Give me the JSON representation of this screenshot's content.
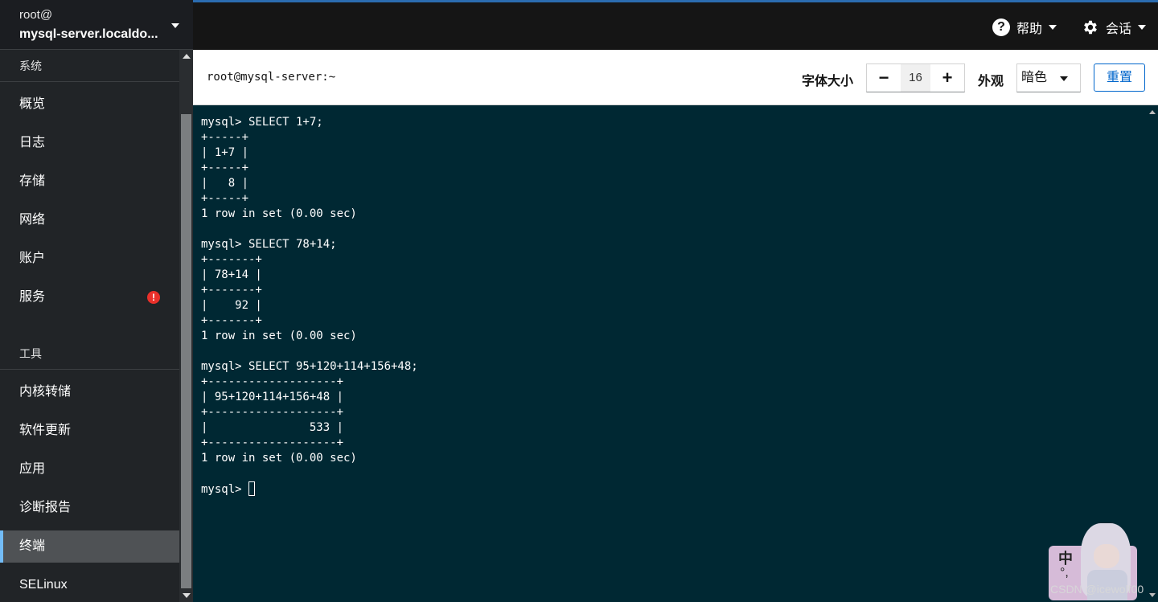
{
  "host": {
    "user": "root@",
    "name": "mysql-server.localdo..."
  },
  "sidebar": {
    "system_label": "系统",
    "tools_label": "工具",
    "items": [
      {
        "label": "概览"
      },
      {
        "label": "日志"
      },
      {
        "label": "存储"
      },
      {
        "label": "网络"
      },
      {
        "label": "账户"
      },
      {
        "label": "服务"
      }
    ],
    "tool_items": [
      {
        "label": "内核转储"
      },
      {
        "label": "软件更新"
      },
      {
        "label": "应用"
      },
      {
        "label": "诊断报告"
      },
      {
        "label": "终端"
      },
      {
        "label": "SELinux"
      }
    ],
    "active": "终端"
  },
  "masthead": {
    "help_label": "帮助",
    "session_label": "会话"
  },
  "toolbar": {
    "terminal_title": "root@mysql-server:~",
    "font_size_label": "字体大小",
    "font_size_value": "16",
    "decrement": "−",
    "increment": "+",
    "appearance_label": "外观",
    "appearance_value": "暗色",
    "reset_label": "重置"
  },
  "terminal": {
    "lines": [
      "mysql> SELECT 1+7;",
      "+-----+",
      "| 1+7 |",
      "+-----+",
      "|   8 |",
      "+-----+",
      "1 row in set (0.00 sec)",
      "",
      "mysql> SELECT 78+14;",
      "+-------+",
      "| 78+14 |",
      "+-------+",
      "|    92 |",
      "+-------+",
      "1 row in set (0.00 sec)",
      "",
      "mysql> SELECT 95+120+114+156+48;",
      "+-------------------+",
      "| 95+120+114+156+48 |",
      "+-------------------+",
      "|               533 |",
      "+-------------------+",
      "1 row in set (0.00 sec)",
      ""
    ],
    "prompt": "mysql> "
  },
  "overlay": {
    "ime_char": "中",
    "ime_punct": "°,",
    "watermark": "CSDN @icewolf00"
  },
  "colors": {
    "terminal_bg": "#002833",
    "accent": "#73bcf7",
    "link": "#0066cc",
    "alert": "#e9302a"
  }
}
